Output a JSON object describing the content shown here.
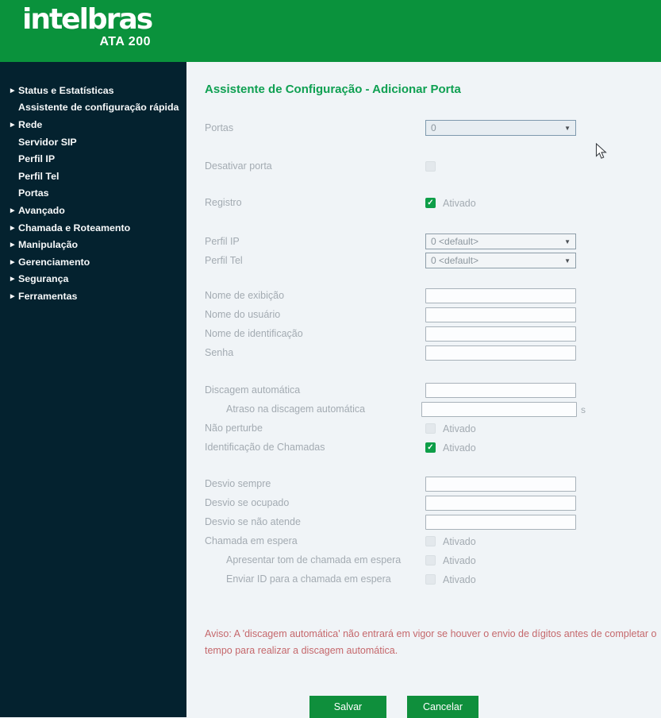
{
  "header": {
    "logo_text": "intelbras",
    "model": "ATA 200"
  },
  "icons": {
    "sidebar_arrow": "▶",
    "dropdown_arrow": "▼",
    "checkmark": "✓"
  },
  "sidebar": {
    "items": [
      {
        "label": "Status e Estatísticas",
        "expandable": true
      },
      {
        "label": "Assistente de configuração rápida",
        "expandable": false
      },
      {
        "label": "Rede",
        "expandable": true
      },
      {
        "label": "Servidor SIP",
        "expandable": false
      },
      {
        "label": "Perfil IP",
        "expandable": false
      },
      {
        "label": "Perfil Tel",
        "expandable": false
      },
      {
        "label": "Portas",
        "expandable": false
      },
      {
        "label": "Avançado",
        "expandable": true
      },
      {
        "label": "Chamada e Roteamento",
        "expandable": true
      },
      {
        "label": "Manipulação",
        "expandable": true
      },
      {
        "label": "Gerenciamento",
        "expandable": true
      },
      {
        "label": "Segurança",
        "expandable": true
      },
      {
        "label": "Ferramentas",
        "expandable": true
      }
    ]
  },
  "main": {
    "title": "Assistente de Configuração - Adicionar Porta",
    "fields": {
      "portas": {
        "label": "Portas",
        "value": "0"
      },
      "desativar_porta": {
        "label": "Desativar porta",
        "checked": false
      },
      "registro": {
        "label": "Registro",
        "checked": true,
        "checkbox_text": "Ativado"
      },
      "perfil_ip": {
        "label": "Perfil IP",
        "value": "0 <default>"
      },
      "perfil_tel": {
        "label": "Perfil Tel",
        "value": "0 <default>"
      },
      "nome_exibicao": {
        "label": "Nome de exibição",
        "value": ""
      },
      "nome_usuario": {
        "label": "Nome do usuário",
        "value": ""
      },
      "nome_identificacao": {
        "label": "Nome de identificação",
        "value": ""
      },
      "senha": {
        "label": "Senha",
        "value": ""
      },
      "discagem_automatica": {
        "label": "Discagem automática",
        "value": ""
      },
      "atraso_discagem": {
        "label": "Atraso na discagem automática",
        "value": "",
        "suffix": "s"
      },
      "nao_perturbe": {
        "label": "Não perturbe",
        "checked": false,
        "checkbox_text": "Ativado"
      },
      "identificacao_chamadas": {
        "label": "Identificação de Chamadas",
        "checked": true,
        "checkbox_text": "Ativado"
      },
      "desvio_sempre": {
        "label": "Desvio sempre",
        "value": ""
      },
      "desvio_ocupado": {
        "label": "Desvio se ocupado",
        "value": ""
      },
      "desvio_nao_atende": {
        "label": "Desvio se não atende",
        "value": ""
      },
      "chamada_espera": {
        "label": "Chamada em espera",
        "checked": false,
        "checkbox_text": "Ativado"
      },
      "tom_chamada_espera": {
        "label": "Apresentar tom de chamada em espera",
        "checked": false,
        "checkbox_text": "Ativado"
      },
      "enviar_id_espera": {
        "label": "Enviar ID para a chamada em espera",
        "checked": false,
        "checkbox_text": "Ativado"
      }
    },
    "warning": "Aviso: A 'discagem automática' não entrará em vigor se houver o envio de dígitos antes de completar o tempo para realizar a discagem automática.",
    "buttons": {
      "save": "Salvar",
      "cancel": "Cancelar"
    }
  },
  "colors": {
    "header_green": "#0A923C",
    "title_green": "#0FA052",
    "checkbox_green": "#0E9E48",
    "button_green": "#0F8F3C",
    "sidebar_navy": "#04222F",
    "content_bg": "#F0F4F7",
    "warning_red": "#C5686C",
    "label_gray": "#A3ABB2"
  }
}
